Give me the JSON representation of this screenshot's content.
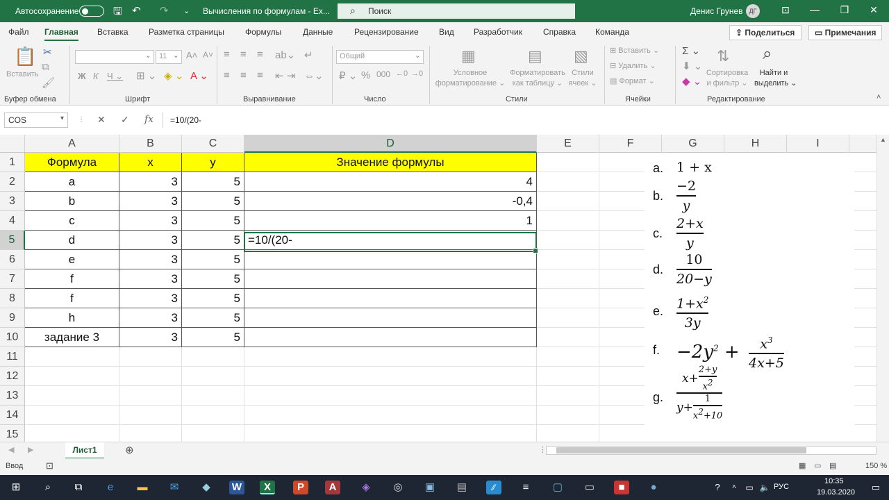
{
  "titlebar": {
    "autosave_label": "Автосохранение",
    "doc_title": "Вычисления по формулам  -  Ex...",
    "search_placeholder": "Поиск",
    "user_name": "Денис Грунев",
    "user_initials": "ДГ"
  },
  "menu": {
    "tabs": [
      "Файл",
      "Главная",
      "Вставка",
      "Разметка страницы",
      "Формулы",
      "Данные",
      "Рецензирование",
      "Вид",
      "Разработчик",
      "Справка",
      "Команда"
    ],
    "share": "Поделиться",
    "comments": "Примечания"
  },
  "ribbon": {
    "paste": "Вставить",
    "font_name": "",
    "font_size": "11",
    "number_format": "Общий",
    "cond_format": [
      "Условное",
      "форматирование ⌄"
    ],
    "format_table": [
      "Форматировать",
      "как таблицу ⌄"
    ],
    "cell_styles": [
      "Стили",
      "ячеек ⌄"
    ],
    "insert": "Вставить",
    "delete": "Удалить",
    "format": "Формат",
    "sort": [
      "Сортировка",
      "и фильтр ⌄"
    ],
    "find": [
      "Найти и",
      "выделить ⌄"
    ],
    "groups": [
      "Буфер обмена",
      "Шрифт",
      "Выравнивание",
      "Число",
      "Стили",
      "Ячейки",
      "Редактирование"
    ]
  },
  "formula_bar": {
    "name_box": "COS",
    "content": "=10/(20-"
  },
  "columns": [
    "A",
    "B",
    "C",
    "D",
    "E",
    "F",
    "G",
    "H",
    "I"
  ],
  "rows": [
    "1",
    "2",
    "3",
    "4",
    "5",
    "6",
    "7",
    "8",
    "9",
    "10",
    "11",
    "12",
    "13",
    "14",
    "15"
  ],
  "table": {
    "header": [
      "Формула",
      "x",
      "y",
      "Значение формулы"
    ],
    "rows": [
      [
        "a",
        "3",
        "5",
        "4"
      ],
      [
        "b",
        "3",
        "5",
        "-0,4"
      ],
      [
        "c",
        "3",
        "5",
        "1"
      ],
      [
        "d",
        "3",
        "5",
        "=10/(20-"
      ],
      [
        "e",
        "3",
        "5",
        ""
      ],
      [
        "f",
        "3",
        "5",
        ""
      ],
      [
        "f",
        "3",
        "5",
        ""
      ],
      [
        "h",
        "3",
        "5",
        ""
      ],
      [
        "задание 3",
        "3",
        "5",
        ""
      ]
    ]
  },
  "formula_list": {
    "labels": [
      "a.",
      "b.",
      "c.",
      "d.",
      "e.",
      "f.",
      "g."
    ],
    "a": "1 + x",
    "b": {
      "num": "−2",
      "den": "y"
    },
    "c": {
      "num": "2+x",
      "den": "y"
    },
    "d": {
      "num": "10",
      "den": "20−y"
    },
    "e": {
      "num": "1+x²",
      "den": "3y"
    },
    "f_prefix": "−2y² +",
    "f": {
      "num": "x³",
      "den": "4x+5"
    },
    "g": {
      "num_a": "x+",
      "num_frac_num": "2+y",
      "num_frac_den": "x²",
      "den_a": "y+",
      "den_frac_num": "1",
      "den_frac_den": "x²+10"
    }
  },
  "sheet_tab": "Лист1",
  "status": {
    "mode": "Ввод",
    "zoom": "150 %"
  },
  "taskbar": {
    "lang": "РУС",
    "time": "10:35",
    "date": "19.03.2020"
  }
}
